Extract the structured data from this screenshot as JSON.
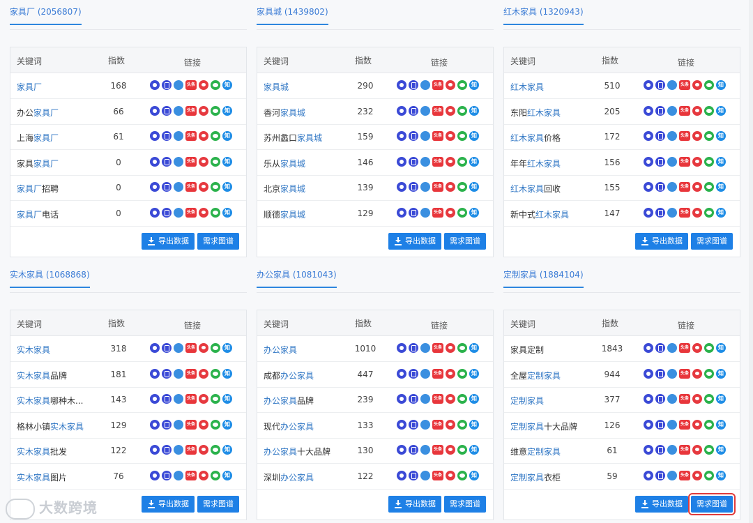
{
  "headers": {
    "keyword": "关键词",
    "index": "指数",
    "links": "链接"
  },
  "buttons": {
    "export": "导出数据",
    "demand": "需求图谱"
  },
  "icon_labels": {
    "toutiao": "头条",
    "zhihu": "知"
  },
  "watermark": "大数跨境",
  "blocks": [
    {
      "title": "家具厂 (2056807)",
      "rows": [
        {
          "pre": "",
          "hl": "家具厂",
          "post": "",
          "index": "168"
        },
        {
          "pre": "办公",
          "hl": "家具厂",
          "post": "",
          "index": "66"
        },
        {
          "pre": "上海",
          "hl": "家具厂",
          "post": "",
          "index": "61"
        },
        {
          "pre": "家具",
          "hl": "家具厂",
          "post": "",
          "index": "0"
        },
        {
          "pre": "",
          "hl": "家具厂",
          "post": "招聘",
          "index": "0"
        },
        {
          "pre": "",
          "hl": "家具厂",
          "post": "电话",
          "index": "0"
        }
      ]
    },
    {
      "title": "家具城 (1439802)",
      "rows": [
        {
          "pre": "",
          "hl": "家具城",
          "post": "",
          "index": "290"
        },
        {
          "pre": "香河",
          "hl": "家具城",
          "post": "",
          "index": "232"
        },
        {
          "pre": "苏州蠡口",
          "hl": "家具城",
          "post": "",
          "index": "159"
        },
        {
          "pre": "乐从",
          "hl": "家具城",
          "post": "",
          "index": "146"
        },
        {
          "pre": "北京",
          "hl": "家具城",
          "post": "",
          "index": "139"
        },
        {
          "pre": "顺德",
          "hl": "家具城",
          "post": "",
          "index": "129"
        }
      ]
    },
    {
      "title": "红木家具 (1320943)",
      "rows": [
        {
          "pre": "",
          "hl": "红木家具",
          "post": "",
          "index": "510"
        },
        {
          "pre": "东阳",
          "hl": "红木家具",
          "post": "",
          "index": "205"
        },
        {
          "pre": "",
          "hl": "红木家具",
          "post": "价格",
          "index": "172"
        },
        {
          "pre": "年年",
          "hl": "红木家具",
          "post": "",
          "index": "156"
        },
        {
          "pre": "",
          "hl": "红木家具",
          "post": "回收",
          "index": "155"
        },
        {
          "pre": "新中式",
          "hl": "红木家具",
          "post": "",
          "index": "147"
        }
      ]
    },
    {
      "title": "实木家具 (1068868)",
      "rows": [
        {
          "pre": "",
          "hl": "实木家具",
          "post": "",
          "index": "318"
        },
        {
          "pre": "",
          "hl": "实木家具",
          "post": "品牌",
          "index": "181"
        },
        {
          "pre": "",
          "hl": "实木家具",
          "post": "哪种木...",
          "index": "143"
        },
        {
          "pre": "格林小镇",
          "hl": "实木家具",
          "post": "",
          "index": "129"
        },
        {
          "pre": "",
          "hl": "实木家具",
          "post": "批发",
          "index": "122"
        },
        {
          "pre": "",
          "hl": "实木家具",
          "post": "图片",
          "index": "76"
        }
      ]
    },
    {
      "title": "办公家具 (1081043)",
      "rows": [
        {
          "pre": "",
          "hl": "办公家具",
          "post": "",
          "index": "1010"
        },
        {
          "pre": "成都",
          "hl": "办公家具",
          "post": "",
          "index": "447"
        },
        {
          "pre": "",
          "hl": "办公家具",
          "post": "品牌",
          "index": "239"
        },
        {
          "pre": "现代",
          "hl": "办公家具",
          "post": "",
          "index": "133"
        },
        {
          "pre": "",
          "hl": "办公家具",
          "post": "十大品牌",
          "index": "130"
        },
        {
          "pre": "深圳",
          "hl": "办公家具",
          "post": "",
          "index": "122"
        }
      ]
    },
    {
      "title": "定制家具 (1884104)",
      "rows": [
        {
          "pre": "家具定制",
          "hl": "",
          "post": "",
          "index": "1843"
        },
        {
          "pre": "全屋",
          "hl": "定制家具",
          "post": "",
          "index": "944"
        },
        {
          "pre": "",
          "hl": "定制家具",
          "post": "",
          "index": "377"
        },
        {
          "pre": "",
          "hl": "定制家具",
          "post": "十大品牌",
          "index": "126"
        },
        {
          "pre": "维意",
          "hl": "定制家具",
          "post": "",
          "index": "61"
        },
        {
          "pre": "",
          "hl": "定制家具",
          "post": "衣柜",
          "index": "59"
        }
      ]
    }
  ]
}
